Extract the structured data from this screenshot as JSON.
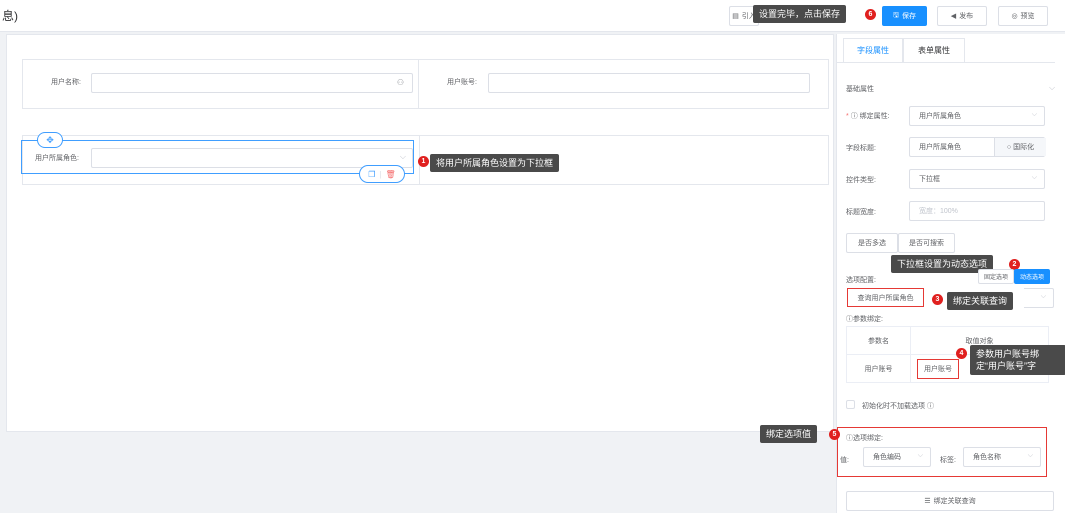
{
  "header": {
    "title": "息)",
    "import_label": "引入",
    "save_label": "保存",
    "publish_label": "发布",
    "preview_label": "预览"
  },
  "form": {
    "user_name_label": "用户名称:",
    "user_account_label": "用户账号:",
    "user_role_label": "用户所属角色:"
  },
  "panel": {
    "tabs": [
      "字段属性",
      "表单属性"
    ],
    "section_basic": "基础属性",
    "bind_attr_label": "绑定属性:",
    "bind_attr_value": "用户所属角色",
    "field_title_label": "字段标题:",
    "field_title_value": "用户所属角色",
    "i18n_label": "国际化",
    "control_type_label": "控件类型:",
    "control_type_value": "下拉框",
    "title_width_label": "标题宽度:",
    "title_width_placeholder": "宽度：100%",
    "multi_select_label": "是否多选",
    "searchable_label": "是否可搜索",
    "option_config_label": "选项配置:",
    "static_option_label": "固定选项",
    "dynamic_option_label": "动态选项",
    "query_value": "查询用户所属角色",
    "param_bind_label": "参数绑定:",
    "param_table_headers": [
      "参数名",
      "取值对象"
    ],
    "param_row": [
      "用户账号",
      "用户账号"
    ],
    "init_no_load_label": "初始化时不加载选项",
    "option_bind_label": "选项绑定:",
    "value_label": "值:",
    "value_select": "角色编码",
    "label_label": "标签:",
    "label_select": "角色名称",
    "bind_query_button": "绑定关联查询"
  },
  "tips": {
    "t1": "将用户所属角色设置为下拉框",
    "t2": "下拉框设置为动态选项",
    "t3": "绑定关联查询",
    "t4_line1": "参数用户账号绑",
    "t4_line2": "定“用户账号”字",
    "t5": "绑定选项值",
    "t6": "设置完毕，点击保存"
  },
  "badges": [
    "1",
    "2",
    "3",
    "4",
    "5",
    "6"
  ],
  "colors": {
    "primary": "#1890ff",
    "annotation_red": "#e53935",
    "tooltip_bg": "#4a4a4a"
  }
}
